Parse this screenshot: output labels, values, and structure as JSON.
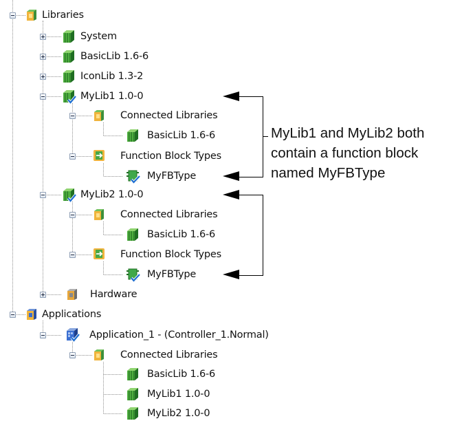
{
  "tree": {
    "root_label": "Libraries",
    "libraries": {
      "system": "System",
      "basiclib": "BasicLib 1.6-6",
      "iconlib": "IconLib 1.3-2",
      "mylib1": {
        "label": "MyLib1 1.0-0",
        "connected_libraries": "Connected Libraries",
        "connected_item": "BasicLib 1.6-6",
        "function_block_types": "Function Block Types",
        "fb_item": "MyFBType"
      },
      "mylib2": {
        "label": "MyLib2 1.0-0",
        "connected_libraries": "Connected Libraries",
        "connected_item": "BasicLib 1.6-6",
        "function_block_types": "Function Block Types",
        "fb_item": "MyFBType"
      }
    },
    "hardware": "Hardware",
    "applications": {
      "label": "Applications",
      "app1": {
        "label": "Application_1 - (Controller_1.Normal)",
        "connected_libraries": "Connected Libraries",
        "items": [
          "BasicLib 1.6-6",
          "MyLib1 1.0-0",
          "MyLib2 1.0-0"
        ]
      }
    }
  },
  "annotation": {
    "lines": [
      "MyLib1 and MyLib2 both",
      "contain a function block",
      "named MyFBType"
    ]
  },
  "colors": {
    "library_green": "#2e9a3a",
    "folder_amber": "#e2a735",
    "fb_blue": "#1f6fd1",
    "app_blue": "#2f63b5",
    "text": "#111111"
  }
}
